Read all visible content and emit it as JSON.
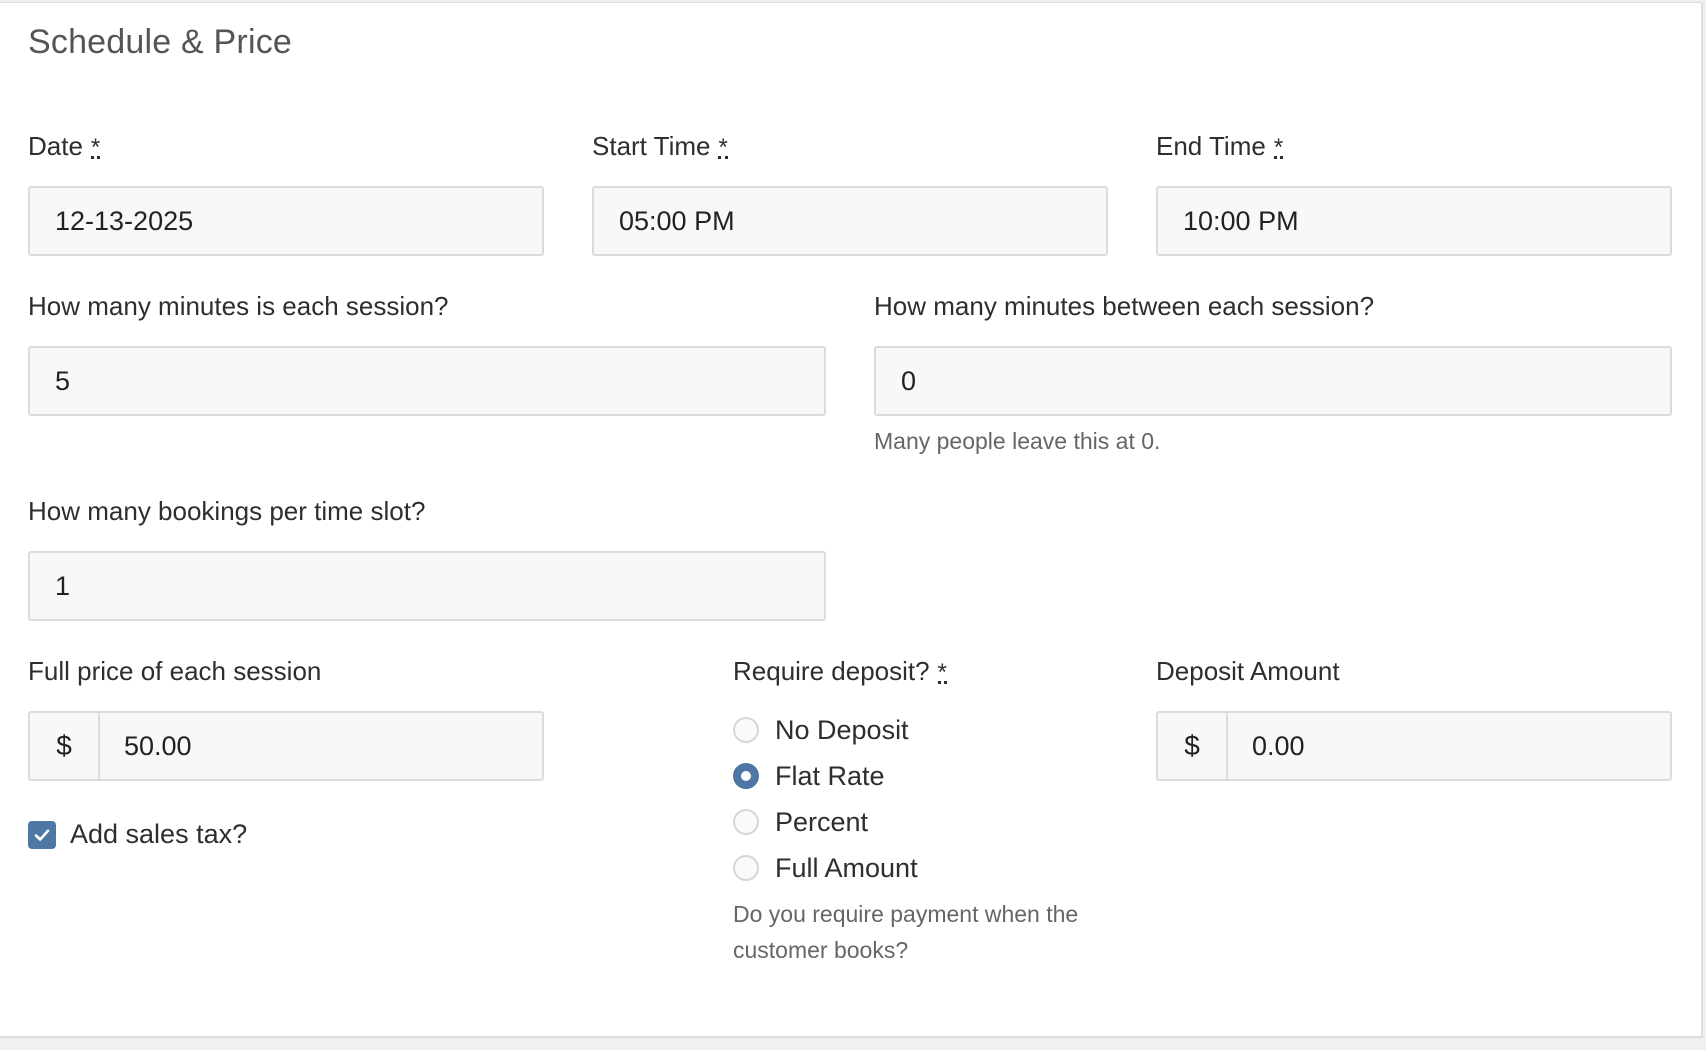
{
  "section": {
    "title": "Schedule & Price"
  },
  "date": {
    "label": "Date",
    "required": "*",
    "value": "12-13-2025"
  },
  "start_time": {
    "label": "Start Time",
    "required": "*",
    "value": "05:00 PM"
  },
  "end_time": {
    "label": "End Time",
    "required": "*",
    "value": "10:00 PM"
  },
  "session_minutes": {
    "label": "How many minutes is each session?",
    "value": "5"
  },
  "between_minutes": {
    "label": "How many minutes between each session?",
    "value": "0",
    "help": "Many people leave this at 0."
  },
  "bookings_per_slot": {
    "label": "How many bookings per time slot?",
    "value": "1"
  },
  "full_price": {
    "label": "Full price of each session",
    "currency": "$",
    "value": "50.00"
  },
  "sales_tax": {
    "label": "Add sales tax?",
    "checked": true
  },
  "deposit": {
    "label": "Require deposit?",
    "required": "*",
    "options": [
      "No Deposit",
      "Flat Rate",
      "Percent",
      "Full Amount"
    ],
    "selected": "Flat Rate",
    "help": "Do you require payment when the customer books?"
  },
  "deposit_amount": {
    "label": "Deposit Amount",
    "currency": "$",
    "value": "0.00"
  },
  "colors": {
    "accent": "#4f77a3",
    "field_bg": "#f8f8f8",
    "border": "#dcdcdc"
  }
}
